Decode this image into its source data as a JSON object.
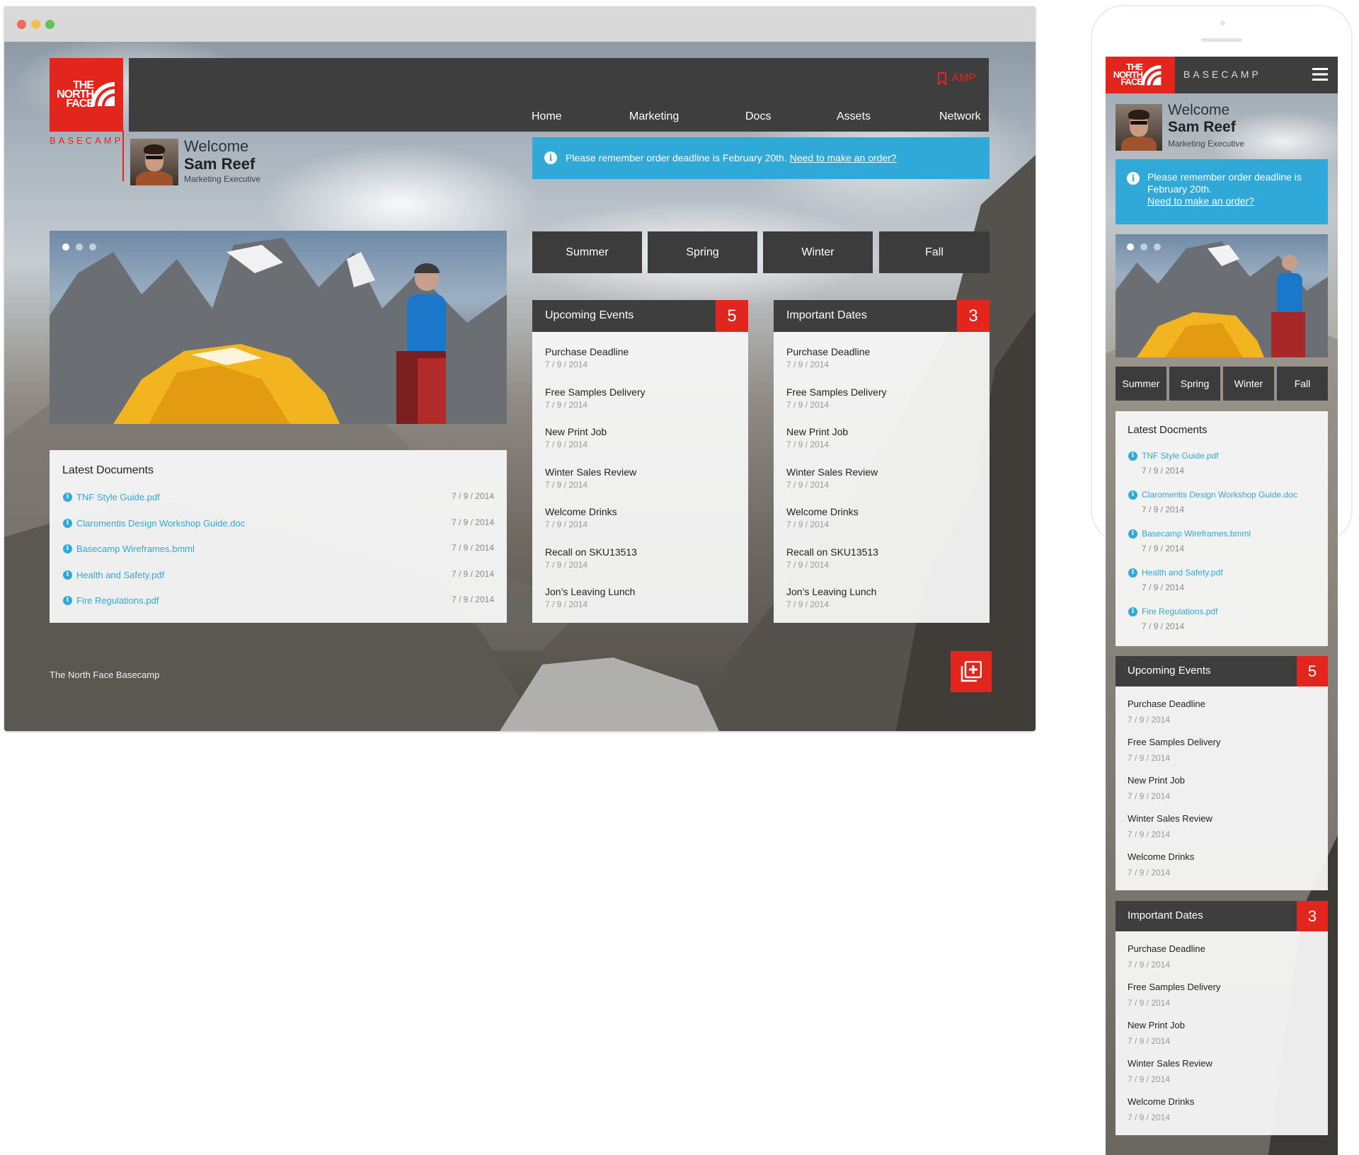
{
  "brand": {
    "logo_lines": [
      "THE",
      "NORTH",
      "FACE"
    ],
    "product": "BASECAMP",
    "accent_color": "#e2261d",
    "info_color": "#30a9d8",
    "dark_color": "#3e3e3e"
  },
  "nav": {
    "amp_label": "AMP",
    "items": [
      "Home",
      "Marketing",
      "Docs",
      "Assets",
      "Network"
    ]
  },
  "user": {
    "welcome": "Welcome",
    "name": "Sam Reef",
    "role": "Marketing Executive"
  },
  "alert": {
    "text": "Please remember order deadline is February 20th.",
    "line1": "Please remember order deadline is",
    "line2": "February 20th.",
    "link": "Need to make an order?"
  },
  "seasons": [
    "Summer",
    "Spring",
    "Winter",
    "Fall"
  ],
  "upcoming_events": {
    "title": "Upcoming Events",
    "count": "5",
    "items": [
      {
        "title": "Purchase Deadline",
        "date": "7 / 9 / 2014"
      },
      {
        "title": "Free Samples Delivery",
        "date": "7 / 9 / 2014"
      },
      {
        "title": "New Print Job",
        "date": "7 / 9 / 2014"
      },
      {
        "title": "Winter Sales Review",
        "date": "7 / 9 / 2014"
      },
      {
        "title": "Welcome Drinks",
        "date": "7 / 9 / 2014"
      },
      {
        "title": "Recall on SKU13513",
        "date": "7 / 9 / 2014"
      },
      {
        "title": "Jon’s Leaving Lunch",
        "date": "7 / 9 / 2014"
      }
    ]
  },
  "important_dates": {
    "title": "Important Dates",
    "count": "3",
    "items": [
      {
        "title": "Purchase Deadline",
        "date": "7 / 9 / 2014"
      },
      {
        "title": "Free Samples Delivery",
        "date": "7 / 9 / 2014"
      },
      {
        "title": "New Print Job",
        "date": "7 / 9 / 2014"
      },
      {
        "title": "Winter Sales Review",
        "date": "7 / 9 / 2014"
      },
      {
        "title": "Welcome Drinks",
        "date": "7 / 9 / 2014"
      },
      {
        "title": "Recall on SKU13513",
        "date": "7 / 9 / 2014"
      },
      {
        "title": "Jon’s Leaving Lunch",
        "date": "7 / 9 / 2014"
      }
    ]
  },
  "documents": {
    "title": "Latest Documents",
    "mobile_title": "Latest Docments",
    "items": [
      {
        "name": "TNF Style Guide.pdf",
        "date": "7 / 9 / 2014"
      },
      {
        "name": "Claromentis Design Workshop Guide.doc",
        "date": "7 / 9 / 2014"
      },
      {
        "name": "Basecamp Wireframes.bmml",
        "date": "7 / 9 / 2014"
      },
      {
        "name": "Health and Safety.pdf",
        "date": "7 / 9 / 2014"
      },
      {
        "name": "Fire Regulations.pdf",
        "date": "7 / 9 / 2014"
      }
    ]
  },
  "footer": {
    "text": "The North Face Basecamp"
  },
  "mobile": {
    "brand_label": "BASECAMP",
    "upcoming_events": {
      "title": "Upcoming Events",
      "count": "5",
      "items": [
        {
          "title": "Purchase Deadline",
          "date": "7 / 9 / 2014"
        },
        {
          "title": "Free Samples Delivery",
          "date": "7 / 9 / 2014"
        },
        {
          "title": "New Print Job",
          "date": "7 / 9 / 2014"
        },
        {
          "title": "Winter Sales Review",
          "date": "7 / 9 / 2014"
        },
        {
          "title": "Welcome Drinks",
          "date": "7 / 9 / 2014"
        }
      ]
    },
    "important_dates": {
      "title": "Important Dates",
      "count": "3",
      "items": [
        {
          "title": "Purchase Deadline",
          "date": "7 / 9 / 2014"
        },
        {
          "title": "Free Samples Delivery",
          "date": "7 / 9 / 2014"
        },
        {
          "title": "New Print Job",
          "date": "7 / 9 / 2014"
        },
        {
          "title": "Winter Sales Review",
          "date": "7 / 9 / 2014"
        },
        {
          "title": "Welcome Drinks",
          "date": "7 / 9 / 2014"
        }
      ]
    }
  },
  "icons": {
    "amp": "bookmark-icon",
    "info": "info-icon",
    "fab": "add-document-icon",
    "menu": "hamburger-menu-icon"
  }
}
